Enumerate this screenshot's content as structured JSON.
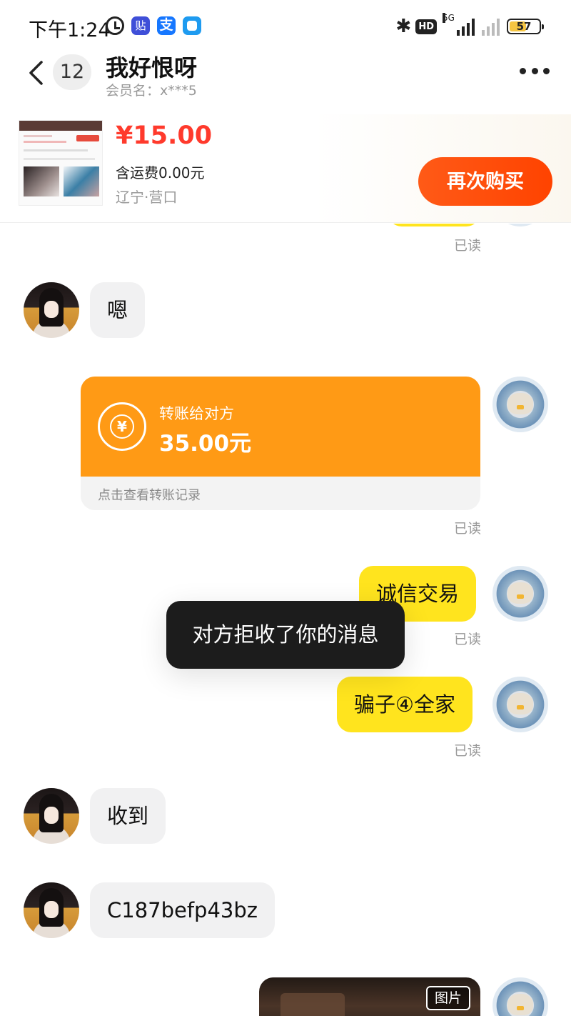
{
  "status_bar": {
    "time": "下午1:24",
    "tieba_icon_text": "贴",
    "alipay_icon_text": "支",
    "network": "5G",
    "hd": "HD",
    "battery": "57",
    "battery_level": 0.57
  },
  "header": {
    "unread_count": "12",
    "title": "我好恨呀",
    "member_name": "会员名：x***5"
  },
  "product": {
    "price": "¥15.00",
    "shipping": "含运费0.00元",
    "location": "辽宁·营口",
    "buy_again_label": "再次购买"
  },
  "messages": {
    "read_label": "已读",
    "m1_text": "嗯",
    "transfer_title": "转账给对方",
    "transfer_amount": "35.00元",
    "transfer_footer": "点击查看转账记录",
    "transfer_currency_symbol": "¥",
    "m3_text": "诚信交易",
    "m4_text": "骗子④全家",
    "m5_text": "收到",
    "m6_text": "C187befp43bz",
    "image_tag": "图片"
  },
  "toast": {
    "text": "对方拒收了你的消息"
  },
  "colors": {
    "accent_orange": "#ff4300",
    "price_red": "#ff3a2c",
    "outgoing_bubble": "#ffe41e",
    "transfer_orange": "#ff9a15"
  }
}
